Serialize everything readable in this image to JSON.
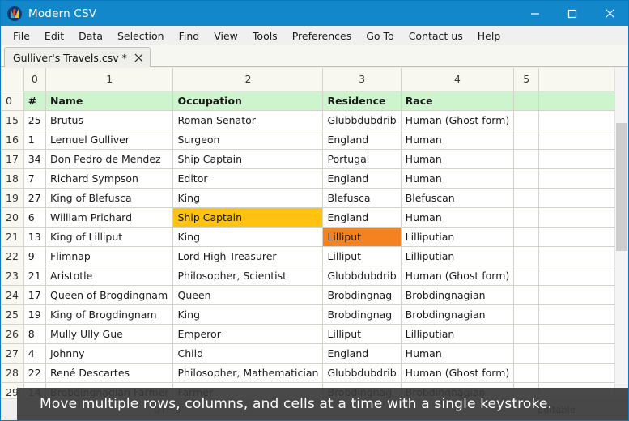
{
  "window": {
    "title": "Modern CSV",
    "icon": "app-logo-icon",
    "controls": {
      "minimize": "minimize-icon",
      "maximize": "maximize-icon",
      "close": "close-icon"
    }
  },
  "menubar": {
    "items": [
      "File",
      "Edit",
      "Data",
      "Selection",
      "Find",
      "View",
      "Tools",
      "Preferences",
      "Go To",
      "Contact us",
      "Help"
    ]
  },
  "tabs": [
    {
      "label": "Gulliver's Travels.csv *",
      "close": "close-icon",
      "active": true
    }
  ],
  "grid": {
    "column_headers": [
      "",
      "0",
      "1",
      "2",
      "3",
      "4",
      "5",
      ""
    ],
    "rows": [
      {
        "num": "0",
        "header_row": true,
        "cells": [
          "#",
          "Name",
          "Occupation",
          "Residence",
          "Race",
          "",
          ""
        ]
      },
      {
        "num": "15",
        "cells": [
          "25",
          "Brutus",
          "Roman Senator",
          "Glubbdubdrib",
          "Human (Ghost form)",
          "",
          ""
        ]
      },
      {
        "num": "16",
        "cells": [
          "1",
          "Lemuel Gulliver",
          "Surgeon",
          "England",
          "Human",
          "",
          ""
        ]
      },
      {
        "num": "17",
        "cells": [
          "34",
          "Don Pedro de Mendez",
          "Ship Captain",
          "Portugal",
          "Human",
          "",
          ""
        ]
      },
      {
        "num": "18",
        "cells": [
          "7",
          "Richard Sympson",
          "Editor",
          "England",
          "Human",
          "",
          ""
        ]
      },
      {
        "num": "19",
        "cells": [
          "27",
          "King of Blefusca",
          "King",
          "Blefusca",
          "Blefuscan",
          "",
          ""
        ]
      },
      {
        "num": "20",
        "cells": [
          "6",
          "William Prichard",
          "Ship Captain",
          "England",
          "Human",
          "",
          ""
        ],
        "highlight": {
          "2": "yellow"
        }
      },
      {
        "num": "21",
        "cells": [
          "13",
          "King of Lilliput",
          "King",
          "Lilliput",
          "Lilliputian",
          "",
          ""
        ],
        "highlight": {
          "3": "orange"
        }
      },
      {
        "num": "22",
        "cells": [
          "9",
          "Flimnap",
          "Lord High Treasurer",
          "Lilliput",
          "Lilliputian",
          "",
          ""
        ]
      },
      {
        "num": "23",
        "cells": [
          "21",
          "Aristotle",
          "Philosopher, Scientist",
          "Glubbdubdrib",
          "Human (Ghost form)",
          "",
          ""
        ]
      },
      {
        "num": "24",
        "cells": [
          "17",
          "Queen of Brogdingnam",
          "Queen",
          "Brobdingnag",
          "Brobdingnagian",
          "",
          ""
        ]
      },
      {
        "num": "25",
        "cells": [
          "19",
          "King of Brogdingnam",
          "King",
          "Brobdingnag",
          "Brobdingnagian",
          "",
          ""
        ]
      },
      {
        "num": "26",
        "cells": [
          "8",
          "Mully Ully Gue",
          "Emperor",
          "Lilliput",
          "Lilliputian",
          "",
          ""
        ]
      },
      {
        "num": "27",
        "cells": [
          "4",
          "Johnny",
          "Child",
          "England",
          "Human",
          "",
          ""
        ]
      },
      {
        "num": "28",
        "cells": [
          "22",
          "René Descartes",
          "Philosopher, Mathematician",
          "Glubbdubdrib",
          "Human (Ghost form)",
          "",
          ""
        ]
      },
      {
        "num": "29",
        "cells": [
          "14",
          "Brobdingnagian Farmer",
          "Farmer",
          "Brobdingnag",
          "Brobdingnagian",
          "",
          ""
        ]
      }
    ]
  },
  "statusbar": {
    "encoding": "UTF-8",
    "editable": "Editable"
  },
  "caption": {
    "text": "Move multiple rows, columns, and cells at a time with a single keystroke."
  },
  "colors": {
    "titlebar": "#1287ca",
    "header_row": "#cdf5cd",
    "highlight_yellow": "#ffc20e",
    "highlight_orange": "#f58220",
    "grid_header": "#f8f8f0"
  }
}
